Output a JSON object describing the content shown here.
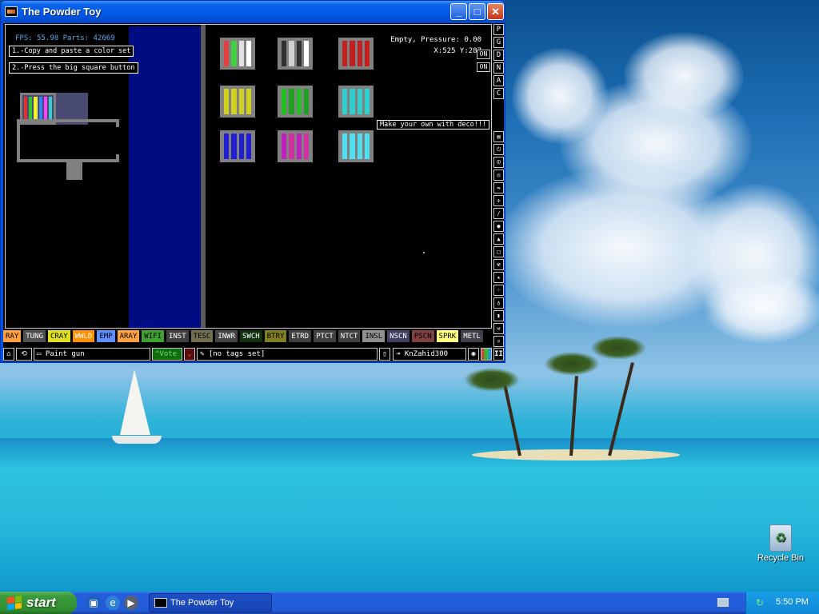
{
  "window": {
    "title": "The Powder Toy",
    "minimize_glyph": "_",
    "maximize_glyph": "□",
    "close_glyph": "✕"
  },
  "hud": {
    "fps_text": "FPS: 55.98 Parts: 42669",
    "pressure_text": "Empty, Pressure: 0.00",
    "coords_text": "X:525 Y:287"
  },
  "annotations": {
    "step1": "1.-Copy and paste a color set",
    "step2": "2.-Press the big square button",
    "deco": "Make your own with deco!!!"
  },
  "machine": {
    "rainbow_colors": [
      "#e03030",
      "#30c030",
      "#f0f030",
      "#3080ff",
      "#ff40ff",
      "#30d0d0"
    ]
  },
  "swatches": [
    {
      "colors": [
        "#e04040",
        "#40d040",
        "#e0e0e0",
        "#ffffff"
      ]
    },
    {
      "colors": [
        "#303030",
        "#d0d0d0",
        "#303030",
        "#ffffff"
      ]
    },
    {
      "colors": [
        "#c02020",
        "#c02020",
        "#c02020",
        "#c02020"
      ]
    },
    {
      "colors": [
        "#d0d020",
        "#d0d020",
        "#d0d020",
        "#d0d020"
      ]
    },
    {
      "colors": [
        "#20c020",
        "#20a020",
        "#20c020",
        "#20a020"
      ]
    },
    {
      "colors": [
        "#30d0d0",
        "#30d0d0",
        "#30d0d0",
        "#30d0d0"
      ]
    },
    {
      "colors": [
        "#2020d0",
        "#2020d0",
        "#2020d0",
        "#2020d0"
      ]
    },
    {
      "colors": [
        "#c020c0",
        "#d030a0",
        "#c020c0",
        "#d030a0"
      ]
    },
    {
      "colors": [
        "#50e0f0",
        "#50e0f0",
        "#50e0f0",
        "#50e0f0"
      ]
    }
  ],
  "right_buttons": {
    "view_modes": [
      "P",
      "G",
      "D",
      "N",
      "A",
      "C"
    ],
    "on_labels": [
      "ON",
      "ON"
    ],
    "tools": [
      "menu-icon",
      "electronic-icon",
      "power-icon",
      "force-icon",
      "tools-icon",
      "special-icon",
      "solid-icon",
      "liquid-icon",
      "gas-icon",
      "wall-icon",
      "radioactive-icon",
      "star-icon",
      "dots-icon",
      "bulb-icon",
      "bookmark-icon",
      "tool-icon",
      "search-icon"
    ]
  },
  "elements": [
    {
      "name": "RAY",
      "bg": "#ffa040",
      "fg": "#000"
    },
    {
      "name": "TUNG",
      "bg": "#505050",
      "fg": "#fff"
    },
    {
      "name": "CRAY",
      "bg": "#e0e020",
      "fg": "#000"
    },
    {
      "name": "WWLD",
      "bg": "#ff9000",
      "fg": "#fff"
    },
    {
      "name": "EMP",
      "bg": "#6090ff",
      "fg": "#000"
    },
    {
      "name": "ARAY",
      "bg": "#ffa040",
      "fg": "#000"
    },
    {
      "name": "WIFI",
      "bg": "#40a030",
      "fg": "#000"
    },
    {
      "name": "INST",
      "bg": "#404040",
      "fg": "#fff"
    },
    {
      "name": "TESC",
      "bg": "#707050",
      "fg": "#000"
    },
    {
      "name": "INWR",
      "bg": "#444444",
      "fg": "#fff"
    },
    {
      "name": "SWCH",
      "bg": "#103010",
      "fg": "#fff"
    },
    {
      "name": "BTRY",
      "bg": "#808020",
      "fg": "#000"
    },
    {
      "name": "ETRD",
      "bg": "#404040",
      "fg": "#fff"
    },
    {
      "name": "PTCT",
      "bg": "#404040",
      "fg": "#fff"
    },
    {
      "name": "NTCT",
      "bg": "#404040",
      "fg": "#fff"
    },
    {
      "name": "INSL",
      "bg": "#909090",
      "fg": "#000"
    },
    {
      "name": "NSCN",
      "bg": "#404060",
      "fg": "#fff"
    },
    {
      "name": "PSCN",
      "bg": "#804040",
      "fg": "#000"
    },
    {
      "name": "SPRK",
      "bg": "#ffff80",
      "fg": "#000"
    },
    {
      "name": "METL",
      "bg": "#404048",
      "fg": "#fff"
    }
  ],
  "bottom_bar": {
    "save_name": "Paint gun",
    "vote_label": "Vote",
    "tags": "[no tags set]",
    "user": "KnZahid300",
    "pause_glyph": "II"
  },
  "desktop": {
    "recycle_bin_label": "Recycle Bin"
  },
  "taskbar": {
    "start_label": "start",
    "task_label": "The Powder Toy",
    "clock": "5:50 PM"
  }
}
